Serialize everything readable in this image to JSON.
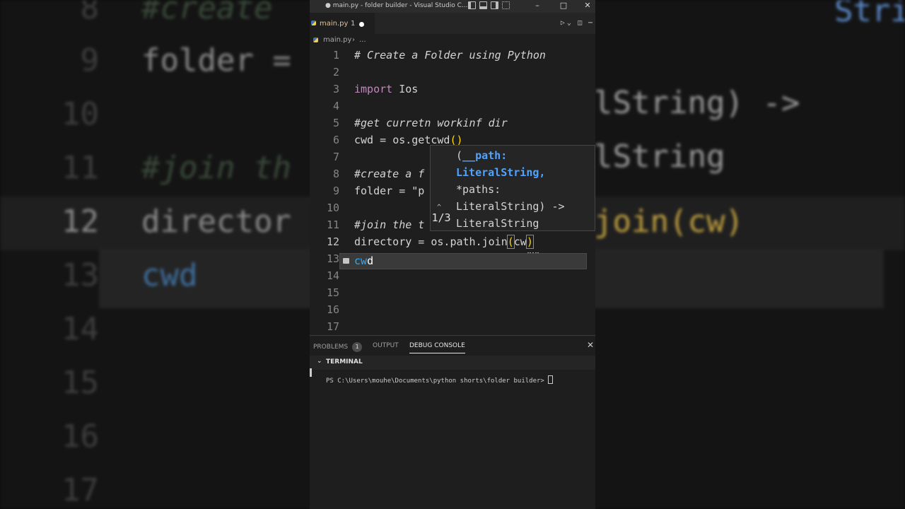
{
  "window": {
    "title": "● main.py - folder builder - Visual Studio C...",
    "controls": [
      "–",
      "□",
      "✕"
    ]
  },
  "tab": {
    "name": "main.py",
    "problems": "1"
  },
  "breadcrumb": {
    "file": "main.py",
    "separator": "›",
    "more": "..."
  },
  "editor": {
    "line_numbers": [
      "1",
      "2",
      "3",
      "4",
      "5",
      "6",
      "7",
      "8",
      "9",
      "10",
      "11",
      "12",
      "13",
      "14",
      "15",
      "16",
      "17"
    ],
    "line1": "# Create a Folder using Python",
    "line3_kw": "import",
    "line3_mod": "os",
    "line5": "#get curretn workinf dir",
    "line6_var": "cwd",
    "line6_eq": " = ",
    "line6_obj": "os",
    "line6_fn": ".getcwd",
    "line6_parens": "()",
    "line8": "#create a f",
    "line9_var": "folder",
    "line9_eq": " = ",
    "line9_str": "\"p",
    "line11": "#join the t",
    "line12_var": "directory",
    "line12_eq": " = ",
    "line12_obj": "os.path",
    "line12_fn": ".join",
    "line12_open": "(",
    "line12_arg": "cw",
    "line12_close": ")"
  },
  "signature_help": {
    "counter": "1/3",
    "line1_prefix": "(",
    "line1_param": "__path:",
    "line2": "LiteralString,",
    "line3": "*paths:",
    "line4": "LiteralString) ->",
    "line5": "LiteralString"
  },
  "suggestion": {
    "match": "cw",
    "rest": "d"
  },
  "panel": {
    "tabs": {
      "problems": "PROBLEMS",
      "problems_count": "1",
      "output": "OUTPUT",
      "debug": "DEBUG CONSOLE"
    },
    "terminal_header": "TERMINAL",
    "prompt": "PS C:\\Users\\mouhe\\Documents\\python shorts\\folder builder> "
  },
  "background": {
    "line_numbers": [
      "8",
      "9",
      "10",
      "11",
      "12",
      "13",
      "14",
      "15",
      "16",
      "17"
    ],
    "line8": "#create",
    "line9": "folder =",
    "line10_sig": "lString) ->",
    "line11": "#join th",
    "line11_sig": "lString",
    "line12": "director",
    "line12_tail": "join(cw)",
    "line13": "cwd",
    "top_right": "String,"
  }
}
